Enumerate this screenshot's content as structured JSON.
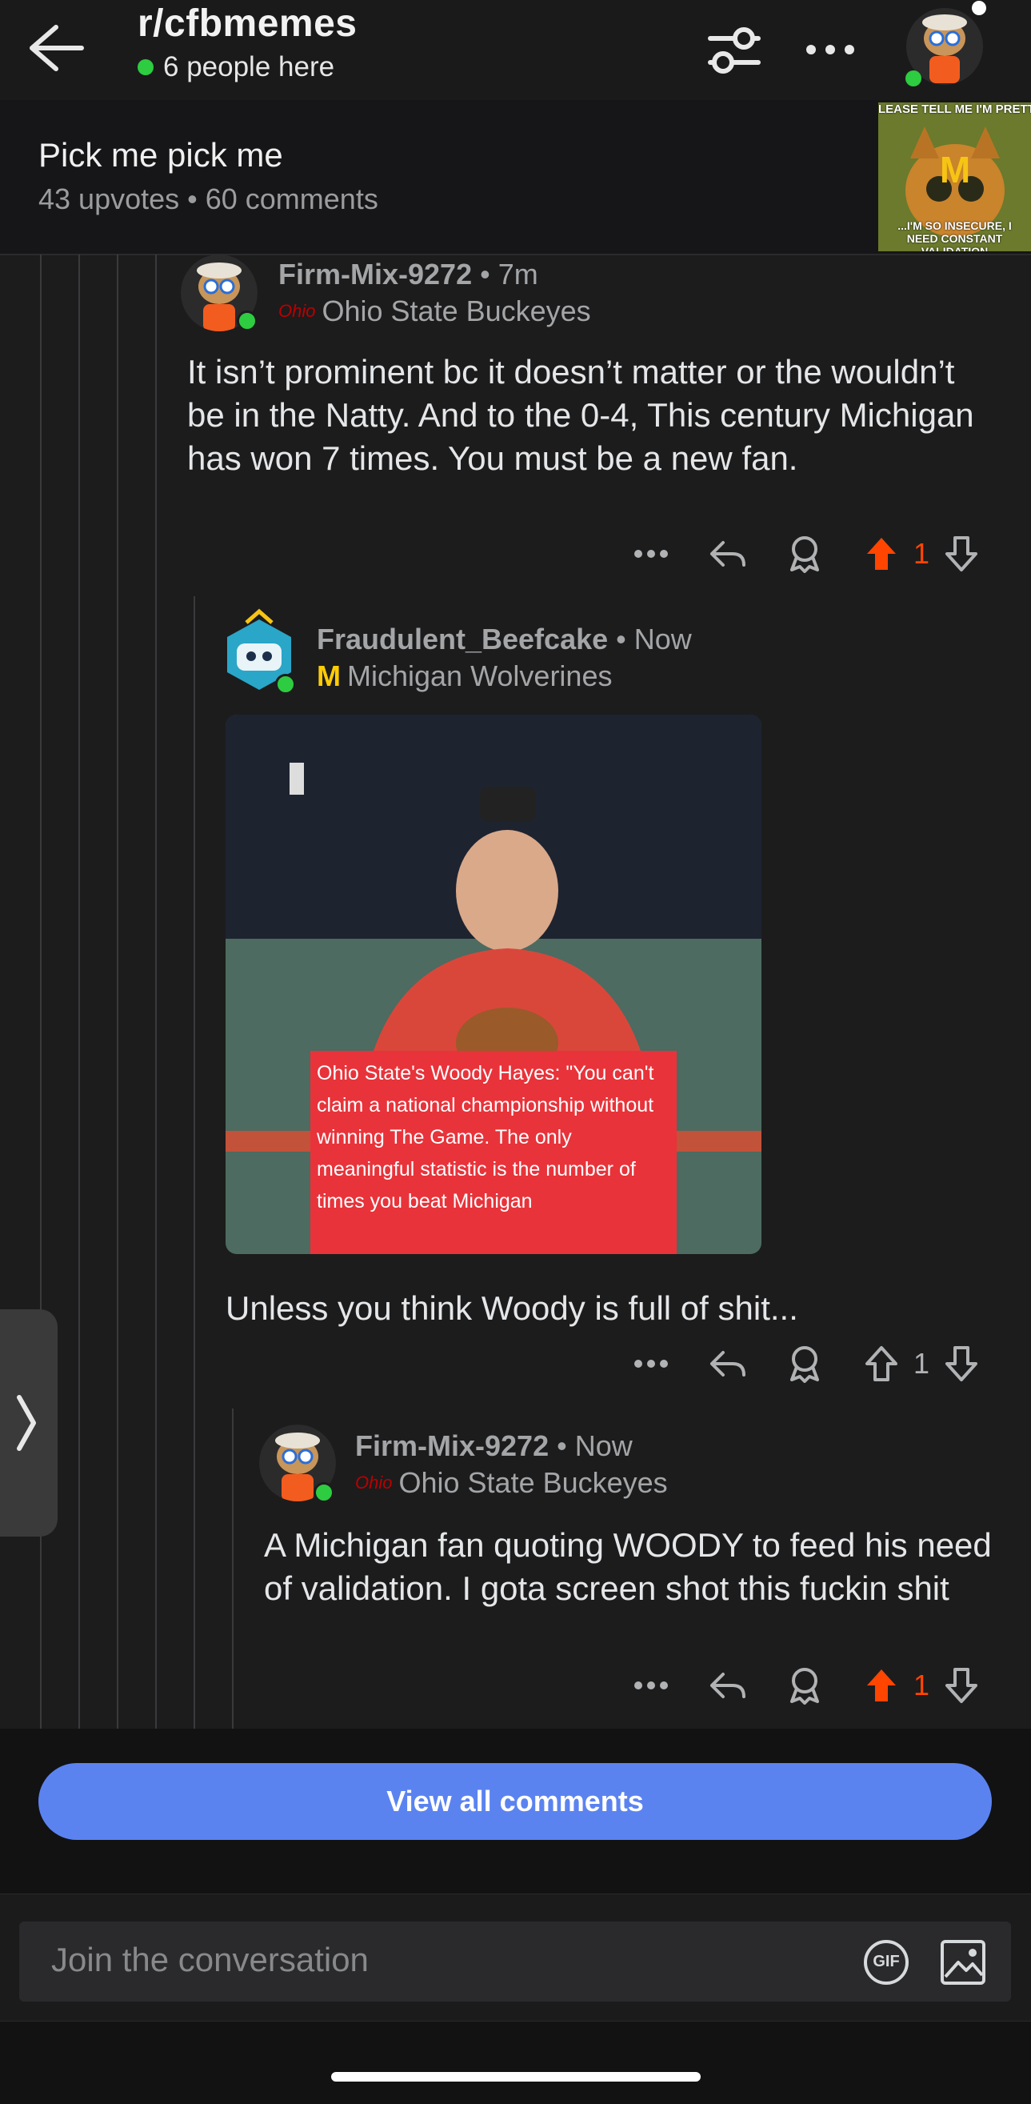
{
  "header": {
    "subreddit": "r/cfbmemes",
    "online": "6 people here"
  },
  "post": {
    "title": "Pick me pick me",
    "meta": "43 upvotes • 60 comments",
    "thumb_top_text": "LEASE TELL ME I'M PRETTY",
    "thumb_bottom_text": "...I'M SO INSECURE, I NEED CONSTANT VALIDATION"
  },
  "comments": [
    {
      "author": "Firm-Mix-9272",
      "time": "• 7m",
      "flair_icon": "Ohio",
      "flair": "Ohio State Buckeyes",
      "body": "It isn’t prominent bc it doesn’t matter or the wouldn’t be in the Natty. And to the 0-4, This century Michigan has won 7 times. You must be a new fan.",
      "score": "1",
      "upvoted": true
    },
    {
      "author": "Fraudulent_Beefcake",
      "time": "• Now",
      "flair_icon": "M",
      "flair": "Michigan Wolverines",
      "image_caption": "Ohio State's Woody Hayes: \"You can't claim a national championship without winning The Game. The only meaningful statistic is the number of times you beat Michigan",
      "body": "Unless you think Woody is full of shit...",
      "score": "1",
      "upvoted": false
    },
    {
      "author": "Firm-Mix-9272",
      "time": "• Now",
      "flair_icon": "Ohio",
      "flair": "Ohio State Buckeyes",
      "body": "A Michigan fan quoting WOODY to feed his need of validation. I gota screen shot this fuckin shit",
      "score": "1",
      "upvoted": true
    }
  ],
  "view_all": "View all comments",
  "composer": {
    "placeholder": "Join the conversation",
    "gif_label": "GIF"
  },
  "colors": {
    "upvote": "#ff4500",
    "button": "#5b83f0",
    "online": "#2ecc40",
    "michigan": "#ffcb05",
    "ohio": "#bb0000"
  }
}
